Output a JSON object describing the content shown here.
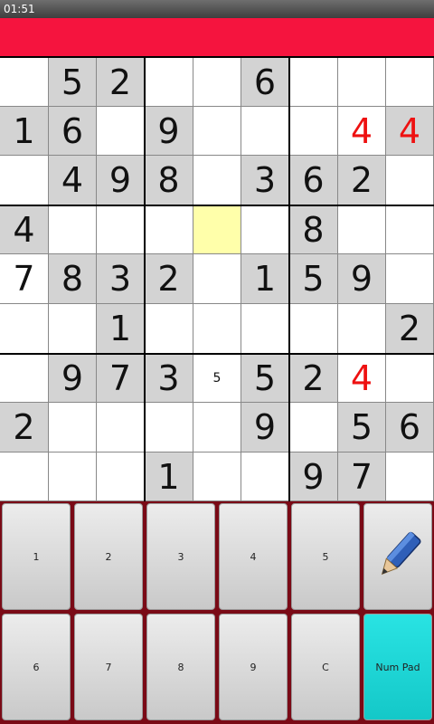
{
  "status": {
    "time": "01:51"
  },
  "colors": {
    "accent": "#f5143e",
    "given": "#d3d3d3",
    "selected": "#ffffaa",
    "conflict": "#ee1111",
    "numpad": "#1fd6d6"
  },
  "board": [
    [
      {
        "v": ""
      },
      {
        "v": "5",
        "g": 1
      },
      {
        "v": "2",
        "g": 1
      },
      {
        "v": ""
      },
      {
        "v": ""
      },
      {
        "v": "6",
        "g": 1
      },
      {
        "v": ""
      },
      {
        "v": ""
      },
      {
        "v": ""
      }
    ],
    [
      {
        "v": "1",
        "g": 1
      },
      {
        "v": "6",
        "g": 1
      },
      {
        "v": ""
      },
      {
        "v": "9",
        "g": 1
      },
      {
        "v": ""
      },
      {
        "v": ""
      },
      {
        "v": ""
      },
      {
        "v": "4",
        "c": 1
      },
      {
        "v": "4",
        "g": 1,
        "c": 1
      }
    ],
    [
      {
        "v": ""
      },
      {
        "v": "4",
        "g": 1
      },
      {
        "v": "9",
        "g": 1
      },
      {
        "v": "8",
        "g": 1
      },
      {
        "v": ""
      },
      {
        "v": "3",
        "g": 1
      },
      {
        "v": "6",
        "g": 1
      },
      {
        "v": "2",
        "g": 1
      },
      {
        "v": ""
      }
    ],
    [
      {
        "v": "4",
        "g": 1
      },
      {
        "v": ""
      },
      {
        "v": ""
      },
      {
        "v": ""
      },
      {
        "v": "",
        "s": 1
      },
      {
        "v": ""
      },
      {
        "v": "8",
        "g": 1
      },
      {
        "v": ""
      },
      {
        "v": ""
      }
    ],
    [
      {
        "v": "7"
      },
      {
        "v": "8",
        "g": 1
      },
      {
        "v": "3",
        "g": 1
      },
      {
        "v": "2",
        "g": 1
      },
      {
        "v": ""
      },
      {
        "v": "1",
        "g": 1
      },
      {
        "v": "5",
        "g": 1
      },
      {
        "v": "9",
        "g": 1
      },
      {
        "v": ""
      }
    ],
    [
      {
        "v": ""
      },
      {
        "v": ""
      },
      {
        "v": "1",
        "g": 1
      },
      {
        "v": ""
      },
      {
        "v": ""
      },
      {
        "v": ""
      },
      {
        "v": ""
      },
      {
        "v": ""
      },
      {
        "v": "2",
        "g": 1
      }
    ],
    [
      {
        "v": ""
      },
      {
        "v": "9",
        "g": 1
      },
      {
        "v": "7",
        "g": 1
      },
      {
        "v": "3",
        "g": 1
      },
      {
        "v": "5",
        "p": 1
      },
      {
        "v": "5",
        "g": 1
      },
      {
        "v": "2",
        "g": 1
      },
      {
        "v": "4",
        "c": 1
      },
      {
        "v": ""
      }
    ],
    [
      {
        "v": "2",
        "g": 1
      },
      {
        "v": ""
      },
      {
        "v": ""
      },
      {
        "v": ""
      },
      {
        "v": ""
      },
      {
        "v": "9",
        "g": 1
      },
      {
        "v": ""
      },
      {
        "v": "5",
        "g": 1
      },
      {
        "v": "6",
        "g": 1
      }
    ],
    [
      {
        "v": ""
      },
      {
        "v": ""
      },
      {
        "v": ""
      },
      {
        "v": "1",
        "g": 1
      },
      {
        "v": ""
      },
      {
        "v": ""
      },
      {
        "v": "9",
        "g": 1
      },
      {
        "v": "7",
        "g": 1
      },
      {
        "v": ""
      }
    ]
  ],
  "keypad": {
    "row1": [
      "1",
      "2",
      "3",
      "4",
      "5"
    ],
    "row2": [
      "6",
      "7",
      "8",
      "9",
      "C"
    ],
    "pencil_icon": "pencil-icon",
    "numpad_label": "Num Pad"
  }
}
